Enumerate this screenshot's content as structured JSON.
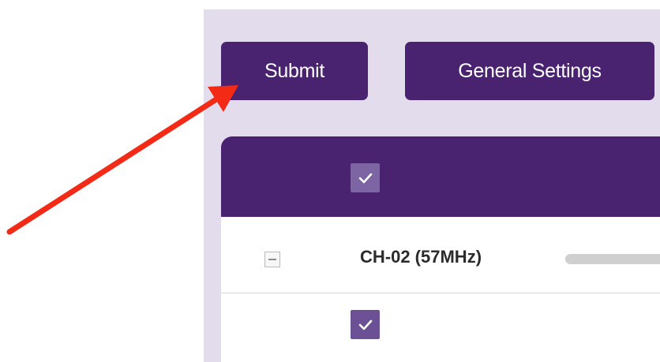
{
  "toolbar": {
    "submit_label": "Submit",
    "general_settings_label": "General Settings"
  },
  "table": {
    "header": {
      "select_all_checked": true
    },
    "rows": [
      {
        "label": "CH-02 (57MHz)",
        "expand_state": "collapsed",
        "progress_fraction": 0
      },
      {
        "label": "",
        "checked": true
      }
    ]
  },
  "colors": {
    "accent": "#4a2370",
    "panel_background": "#e3dced",
    "checkbox": "#6c5095",
    "annotation_arrow": "#f22a16"
  }
}
